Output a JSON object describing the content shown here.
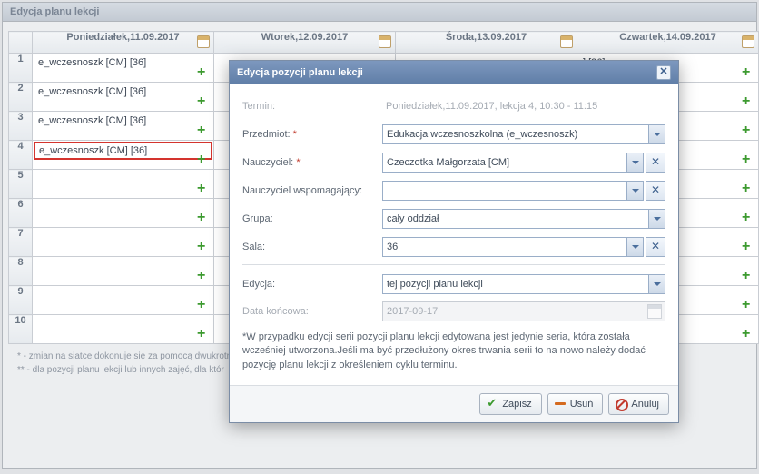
{
  "panel_title": "Edycja planu lekcji",
  "days": [
    "Poniedziałek,11.09.2017",
    "Wtorek,12.09.2017",
    "Środa,13.09.2017",
    "Czwartek,14.09.2017"
  ],
  "row_numbers": [
    "1",
    "2",
    "3",
    "4",
    "5",
    "6",
    "7",
    "8",
    "9",
    "10"
  ],
  "entries": {
    "mon": [
      "e_wczesnoszk [CM] [36]",
      "e_wczesnoszk [CM] [36]",
      "e_wczesnoszk [CM] [36]",
      "e_wczesnoszk [CM] [36]"
    ],
    "thu_fragment": "] [36]"
  },
  "footnotes": [
    "* - zmian na siatce dokonuje się za pomocą dwukrotne",
    "** - dla pozycji planu lekcji lub innych zajęć, dla któr"
  ],
  "modal": {
    "title": "Edycja pozycji planu lekcji",
    "labels": {
      "termin": "Termin:",
      "przedmiot": "Przedmiot:",
      "nauczyciel": "Nauczyciel:",
      "wspomagajacy": "Nauczyciel wspomagający:",
      "grupa": "Grupa:",
      "sala": "Sala:",
      "edycja": "Edycja:",
      "data_koncowa": "Data końcowa:"
    },
    "values": {
      "termin": "Poniedziałek,11.09.2017, lekcja 4, 10:30 - 11:15",
      "przedmiot": "Edukacja wczesnoszkolna (e_wczesnoszk)",
      "nauczyciel": "Czeczotka Małgorzata [CM]",
      "wspomagajacy": "",
      "grupa": "cały oddział",
      "sala": "36",
      "edycja": "tej pozycji planu lekcji",
      "data_koncowa": "2017-09-17"
    },
    "note": "*W przypadku edycji serii pozycji planu lekcji edytowana jest jedynie seria, która została wcześniej utworzona.Jeśli ma być przedłużony okres trwania serii to na nowo należy dodać pozycję planu lekcji z określeniem cyklu terminu.",
    "buttons": {
      "save": "Zapisz",
      "delete": "Usuń",
      "cancel": "Anuluj"
    }
  }
}
